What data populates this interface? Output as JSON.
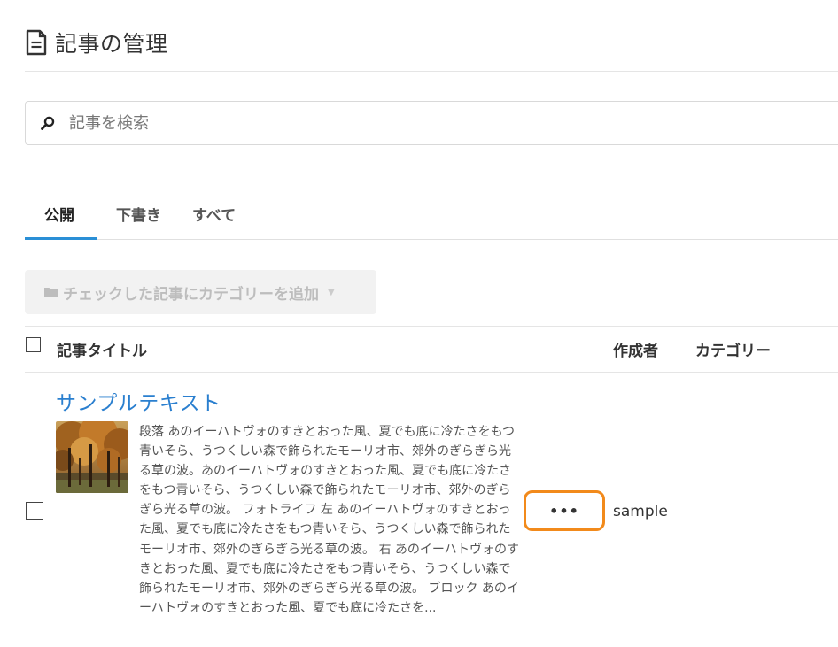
{
  "header": {
    "title": "記事の管理",
    "icon": "document-icon"
  },
  "search": {
    "placeholder": "記事を検索",
    "icon": "search-icon"
  },
  "tabs": [
    {
      "label": "公開",
      "active": true
    },
    {
      "label": "下書き",
      "active": false
    },
    {
      "label": "すべて",
      "active": false
    }
  ],
  "bulk_action": {
    "label": "チェックした記事にカテゴリーを追加",
    "icon": "folder-icon",
    "disabled": true
  },
  "table": {
    "columns": {
      "title": "記事タイトル",
      "author": "作成者",
      "category": "カテゴリー"
    },
    "rows": [
      {
        "title": "サンプルテキスト",
        "excerpt": "段落 あのイーハトヴォのすきとおった風、夏でも底に冷たさをもつ青いそら、うつくしい森で飾られたモーリオ市、郊外のぎらぎら光る草の波。あのイーハトヴォのすきとおった風、夏でも底に冷たさをもつ青いそら、うつくしい森で飾られたモーリオ市、郊外のぎらぎら光る草の波。 フォトライフ 左 あのイーハトヴォのすきとおった風、夏でも底に冷たさをもつ青いそら、うつくしい森で飾られたモーリオ市、郊外のぎらぎら光る草の波。 右 あのイーハトヴォのすきとおった風、夏でも底に冷たさをもつ青いそら、うつくしい森で飾られたモーリオ市、郊外のぎらぎら光る草の波。 ブロック あのイーハトヴォのすきとおった風、夏でも底に冷たさを...",
        "more_label": "•••",
        "author": "sample",
        "category": ""
      }
    ]
  },
  "colors": {
    "accent": "#2a8fd6",
    "link": "#2a7fcf",
    "highlight": "#f28a1b"
  }
}
